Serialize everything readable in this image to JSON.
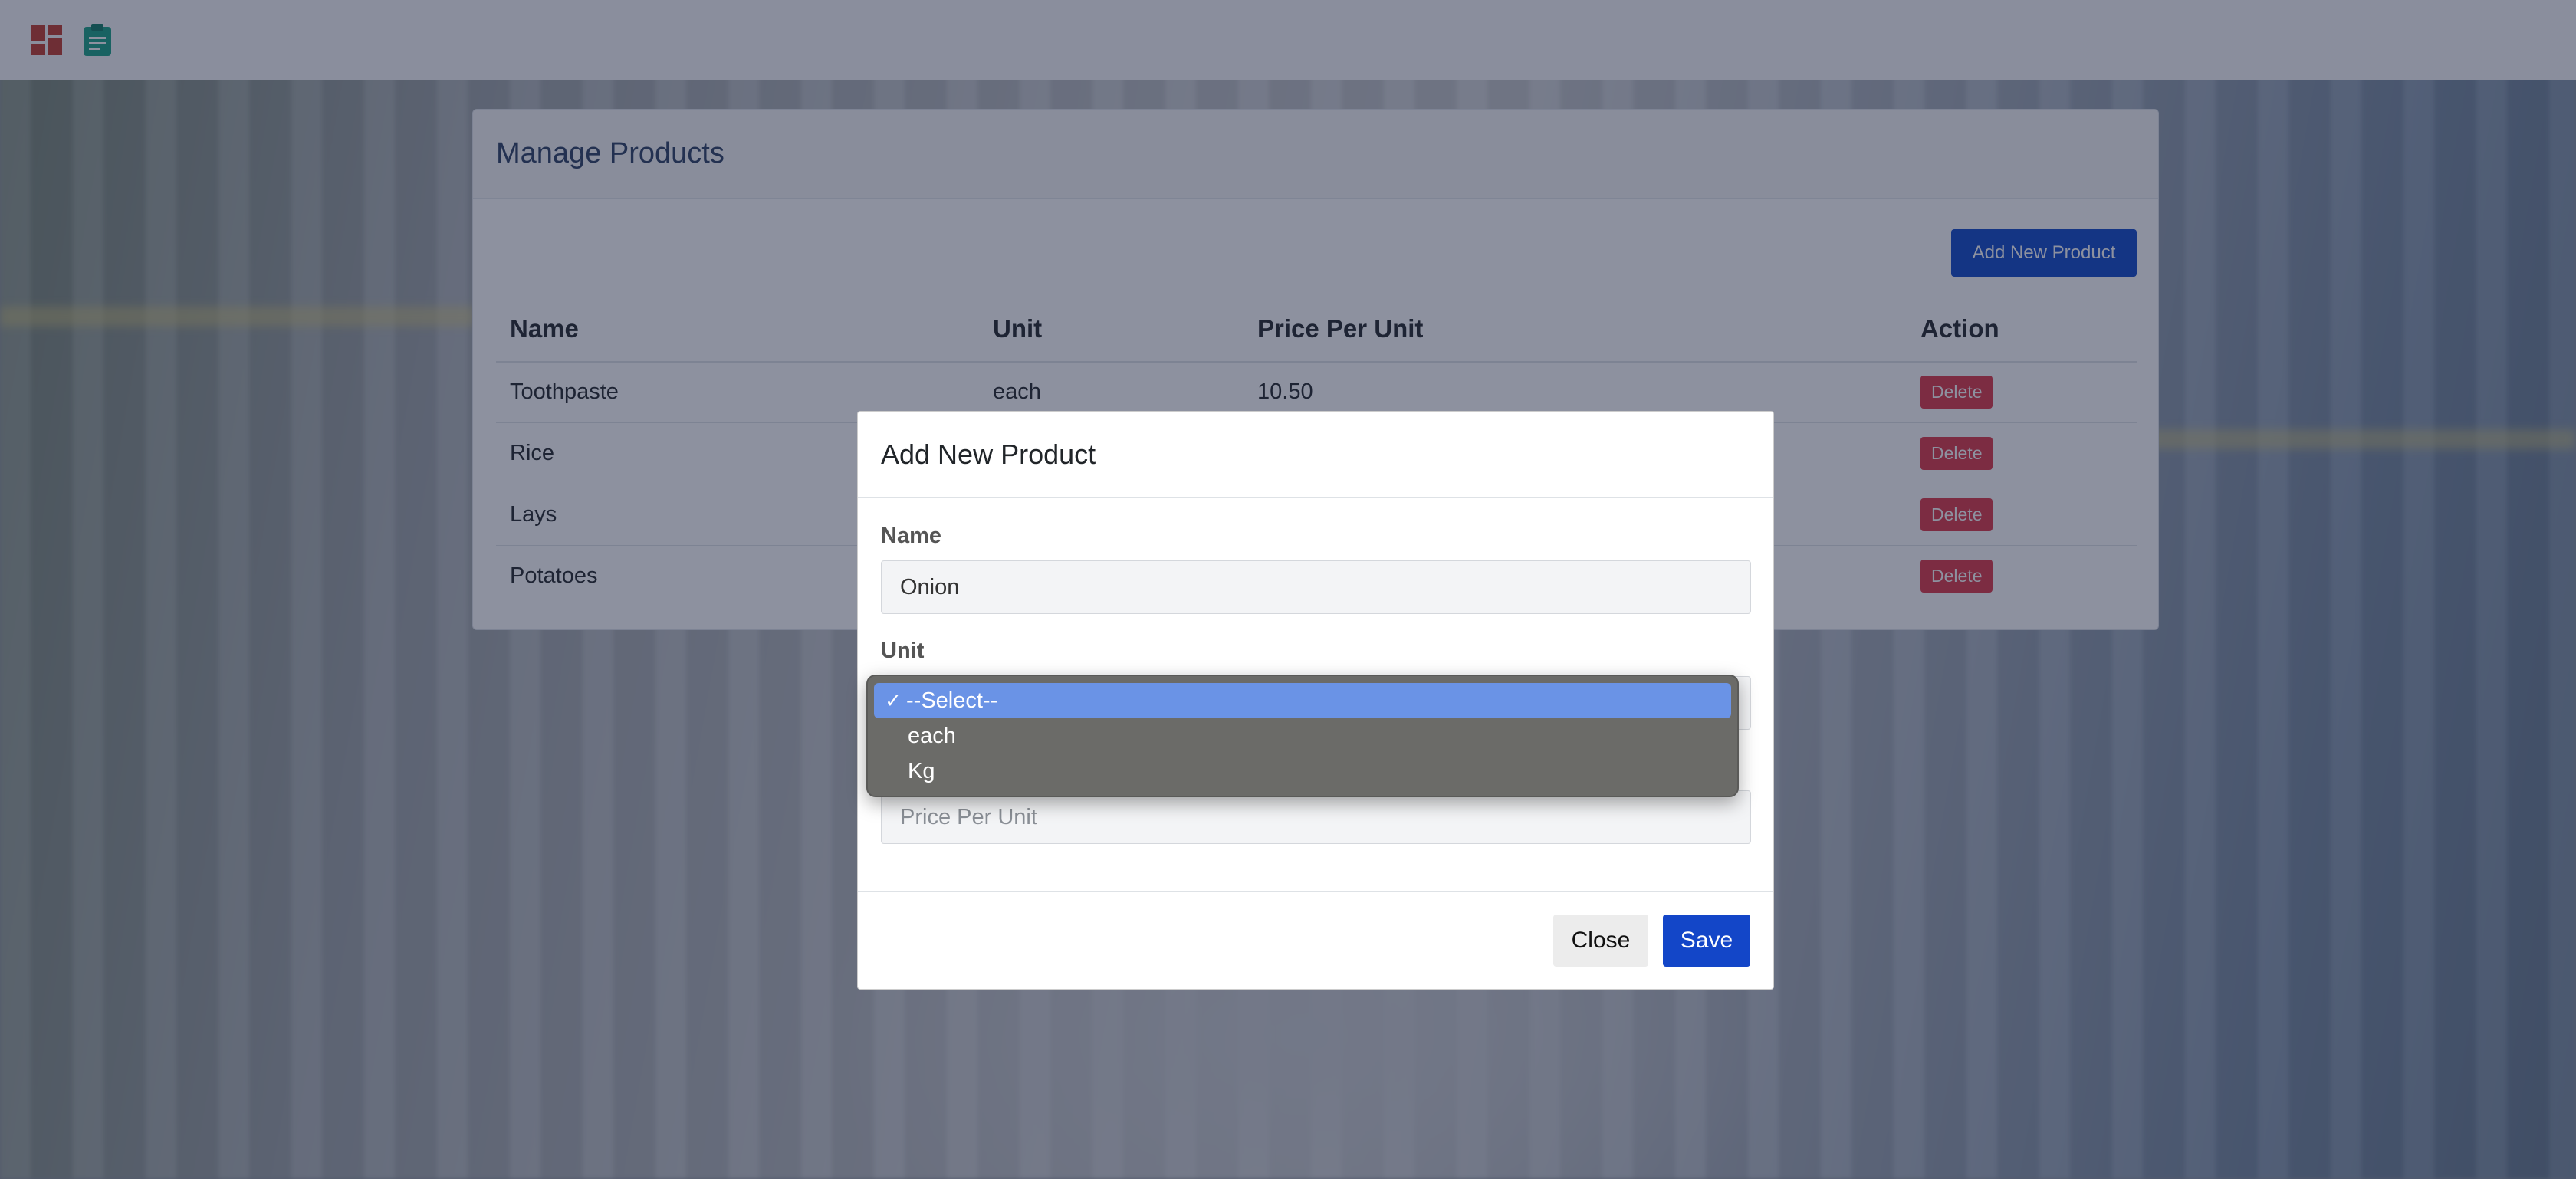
{
  "navbar": {
    "icons": [
      "dashboard-icon",
      "clipboard-icon"
    ],
    "dashboard_color": "#c0392b",
    "clipboard_color": "#16a085"
  },
  "manage_products": {
    "title": "Manage Products",
    "add_button_label": "Add New Product",
    "columns": [
      "Name",
      "Unit",
      "Price Per Unit",
      "Action"
    ],
    "rows": [
      {
        "name": "Toothpaste",
        "unit": "each",
        "price": "10.50",
        "action": "Delete"
      },
      {
        "name": "Rice",
        "unit": "",
        "price": "",
        "action": "Delete"
      },
      {
        "name": "Lays",
        "unit": "",
        "price": "",
        "action": "Delete"
      },
      {
        "name": "Potatoes",
        "unit": "",
        "price": "",
        "action": "Delete"
      }
    ]
  },
  "modal": {
    "title": "Add New Product",
    "name_label": "Name",
    "name_value": "Onion",
    "unit_label": "Unit",
    "unit_options": [
      "--Select--",
      "each",
      "Kg"
    ],
    "unit_selected": "--Select--",
    "price_placeholder": "Price Per Unit",
    "close_label": "Close",
    "save_label": "Save"
  },
  "colors": {
    "primary": "#1346c8",
    "danger": "#dc3545",
    "dropdown_highlight": "#6a93e6"
  }
}
